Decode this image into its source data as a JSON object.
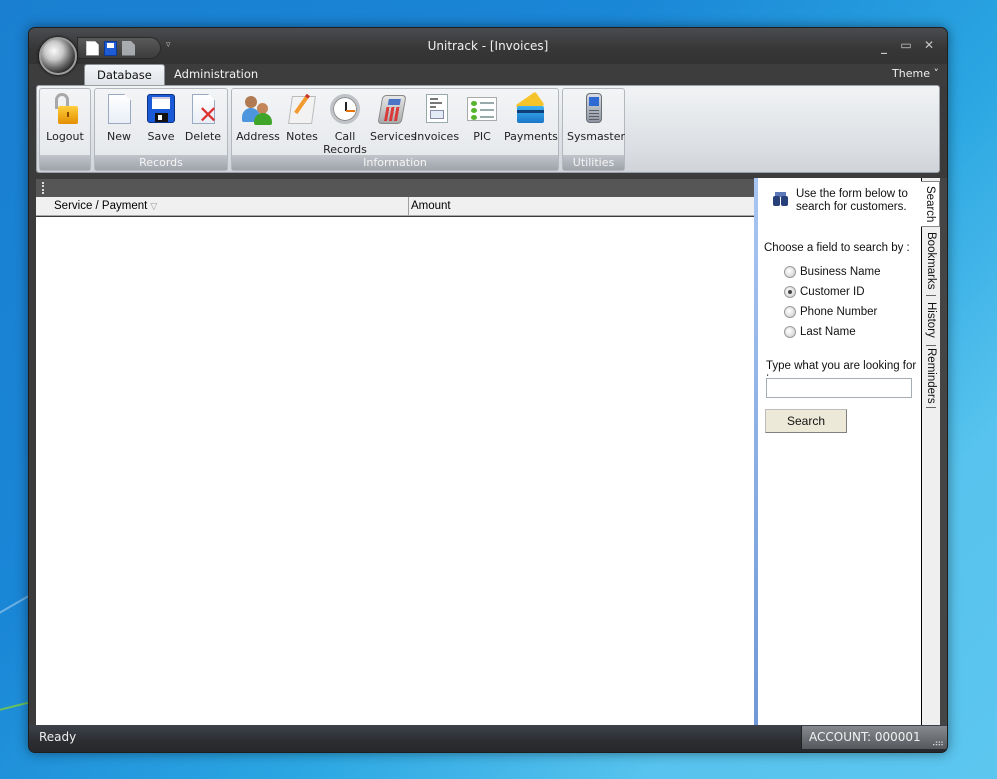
{
  "window": {
    "title": "Unitrack - [Invoices]",
    "controls": {
      "minimize": "_",
      "maximize": "▭",
      "close": "✕"
    }
  },
  "quick_access": {
    "items": [
      "new-document",
      "save",
      "delete"
    ],
    "more": "▿"
  },
  "ribbon": {
    "tabs": [
      {
        "label": "Database",
        "active": true
      },
      {
        "label": "Administration",
        "active": false
      }
    ],
    "theme_label": "Theme",
    "theme_arrow": "˅",
    "groups": [
      {
        "label": "",
        "buttons": [
          {
            "label": "Logout",
            "icon": "lock-icon"
          }
        ]
      },
      {
        "label": "Records",
        "buttons": [
          {
            "label": "New",
            "icon": "new-document-icon"
          },
          {
            "label": "Save",
            "icon": "floppy-disk-icon"
          },
          {
            "label": "Delete",
            "icon": "delete-document-icon"
          }
        ]
      },
      {
        "label": "Information",
        "buttons": [
          {
            "label": "Address",
            "icon": "people-icon"
          },
          {
            "label": "Notes",
            "icon": "notepad-icon"
          },
          {
            "label": "Call\nRecords",
            "line1": "Call",
            "line2": "Records",
            "icon": "clock-icon"
          },
          {
            "label": "Services",
            "icon": "telephone-icon"
          },
          {
            "label": "Invoices",
            "icon": "invoice-icon"
          },
          {
            "label": "PIC",
            "icon": "checklist-icon"
          },
          {
            "label": "Payments",
            "icon": "credit-card-icon"
          }
        ]
      },
      {
        "label": "Utilities",
        "buttons": [
          {
            "label": "Sysmaster",
            "icon": "pda-icon"
          }
        ]
      }
    ]
  },
  "grid": {
    "columns": [
      {
        "label": "Service / Payment",
        "sort_indicator": "▽"
      },
      {
        "label": "Amount"
      }
    ],
    "rows": []
  },
  "search_panel": {
    "intro": "Use the form below to search for customers.",
    "choose_label": "Choose a field to search by :",
    "options": [
      {
        "label": "Business Name",
        "checked": false
      },
      {
        "label": "Customer ID",
        "checked": true
      },
      {
        "label": "Phone Number",
        "checked": false
      },
      {
        "label": "Last Name",
        "checked": false
      }
    ],
    "type_label": "Type what you are looking for :",
    "input_value": "",
    "button_label": "Search"
  },
  "side_tabs": [
    {
      "label": "Search",
      "active": true
    },
    {
      "label": "Bookmarks",
      "active": false
    },
    {
      "label": "History",
      "active": false
    },
    {
      "label": "Reminders",
      "active": false
    }
  ],
  "status": {
    "text": "Ready",
    "account": "ACCOUNT: 000001",
    "grip": "⠴⠶"
  }
}
